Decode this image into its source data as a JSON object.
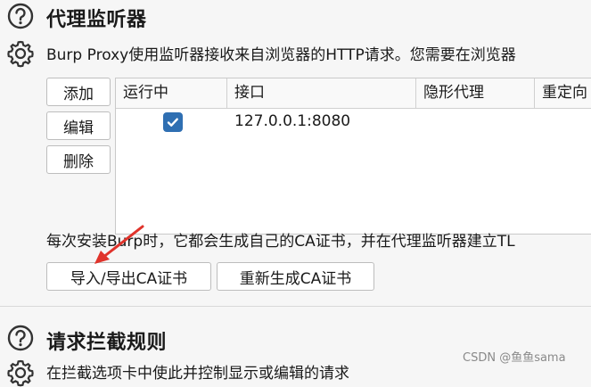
{
  "listeners_section": {
    "title": "代理监听器",
    "description": "Burp Proxy使用监听器接收来自浏览器的HTTP请求。您需要在浏览器",
    "buttons": {
      "add": "添加",
      "edit": "编辑",
      "remove": "删除"
    },
    "table": {
      "columns": [
        "运行中",
        "接口",
        "隐形代理",
        "重定向"
      ],
      "rows": [
        {
          "running": true,
          "interface": "127.0.0.1:8080",
          "invisible": "",
          "redirect": ""
        }
      ]
    },
    "ca_note": "每次安装Burp时，它都会生成自己的CA证书，并在代理监听器建立TL",
    "ca_buttons": {
      "import_export": "导入/导出CA证书",
      "regenerate": "重新生成CA证书"
    }
  },
  "intercept_section": {
    "title": "请求拦截规则",
    "description_partial": "在拦截选项卡中使此并控制显示或编辑的请求"
  },
  "watermark": "CSDN @鱼鱼sama",
  "colors": {
    "accent": "#2f6fb2",
    "arrow": "#e0332b"
  }
}
